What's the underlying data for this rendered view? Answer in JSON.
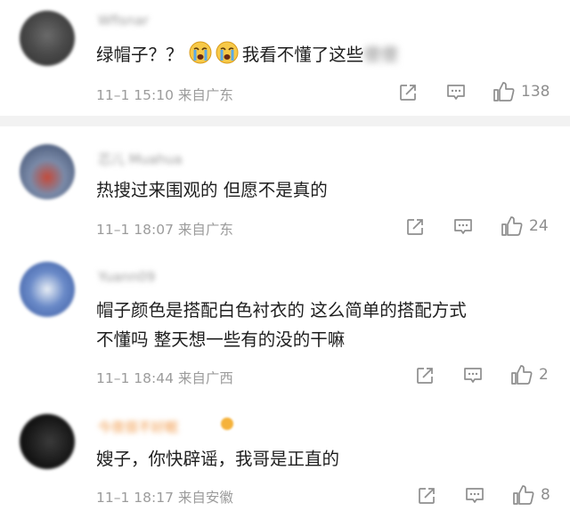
{
  "comments": [
    {
      "username": "Wfisnar",
      "text_prefix": "绿帽子？？",
      "emojis": [
        "crying-face-emoji",
        "crying-face-emoji"
      ],
      "text_suffix": "我看不懂了这些",
      "text_hidden": "傻傻",
      "time": "11–1 15:10",
      "location": "来自广东",
      "likes": "138"
    },
    {
      "username": "芯儿 Muahua",
      "text": "热搜过来围观的  但愿不是真的",
      "time": "11–1 18:07",
      "location": "来自广东",
      "likes": "24"
    },
    {
      "username": "Yuann09",
      "text_line1": "帽子颜色是搭配白色衬衣的  这么简单的搭配方式",
      "text_line2": "不懂吗  整天想一些有的没的干嘛",
      "time": "11–1 18:44",
      "location": "来自广西",
      "likes": "2"
    },
    {
      "username": "今夜很不好眠",
      "text": "嫂子，你快辟谣，我哥是正直的",
      "time": "11–1 18:17",
      "location": "来自安徽",
      "likes": "8"
    }
  ],
  "colors": {
    "meta_gray": "#9c9c9c",
    "icon_gray": "#8e8e8e",
    "divider": "#f2f2f2",
    "vip_orange": "#f19a4a"
  }
}
